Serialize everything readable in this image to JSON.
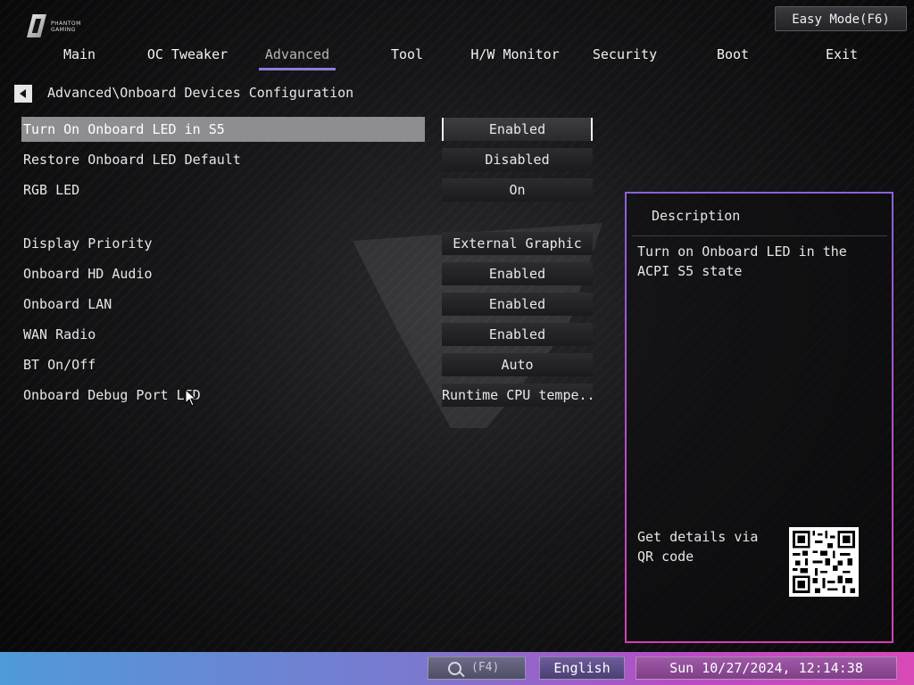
{
  "brand": {
    "line1": "PHANTOM",
    "line2": "GAMING"
  },
  "easy_mode_label": "Easy Mode(F6)",
  "tabs": [
    {
      "label": "Main"
    },
    {
      "label": "OC Tweaker"
    },
    {
      "label": "Advanced",
      "active": true
    },
    {
      "label": "Tool"
    },
    {
      "label": "H/W Monitor"
    },
    {
      "label": "Security"
    },
    {
      "label": "Boot"
    },
    {
      "label": "Exit"
    }
  ],
  "breadcrumb": "Advanced\\Onboard Devices Configuration",
  "settings": [
    {
      "label": "Turn On Onboard LED in S5",
      "value": "Enabled",
      "selected": true
    },
    {
      "label": "Restore Onboard LED Default",
      "value": "Disabled"
    },
    {
      "label": "RGB LED",
      "value": "On"
    },
    {
      "label": "Display Priority",
      "value": "External Graphic"
    },
    {
      "label": "Onboard HD Audio",
      "value": "Enabled"
    },
    {
      "label": "Onboard LAN",
      "value": "Enabled"
    },
    {
      "label": "WAN Radio",
      "value": "Enabled"
    },
    {
      "label": "BT On/Off",
      "value": "Auto"
    },
    {
      "label": "Onboard Debug Port LED",
      "value": "Runtime CPU tempe..."
    }
  ],
  "description": {
    "title": "Description",
    "text": "Turn on Onboard LED in the ACPI S5 state",
    "qr_text": "Get details via QR code"
  },
  "bottom_bar": {
    "search_key": "(F4)",
    "language": "English",
    "datetime": "Sun 10/27/2024, 12:14:38"
  },
  "colors": {
    "active_tab_underline": "#8a7fd6",
    "selected_row": "#8e8e90",
    "panel_border_top": "#8a63d8",
    "panel_border_bottom": "#d53fb4"
  }
}
